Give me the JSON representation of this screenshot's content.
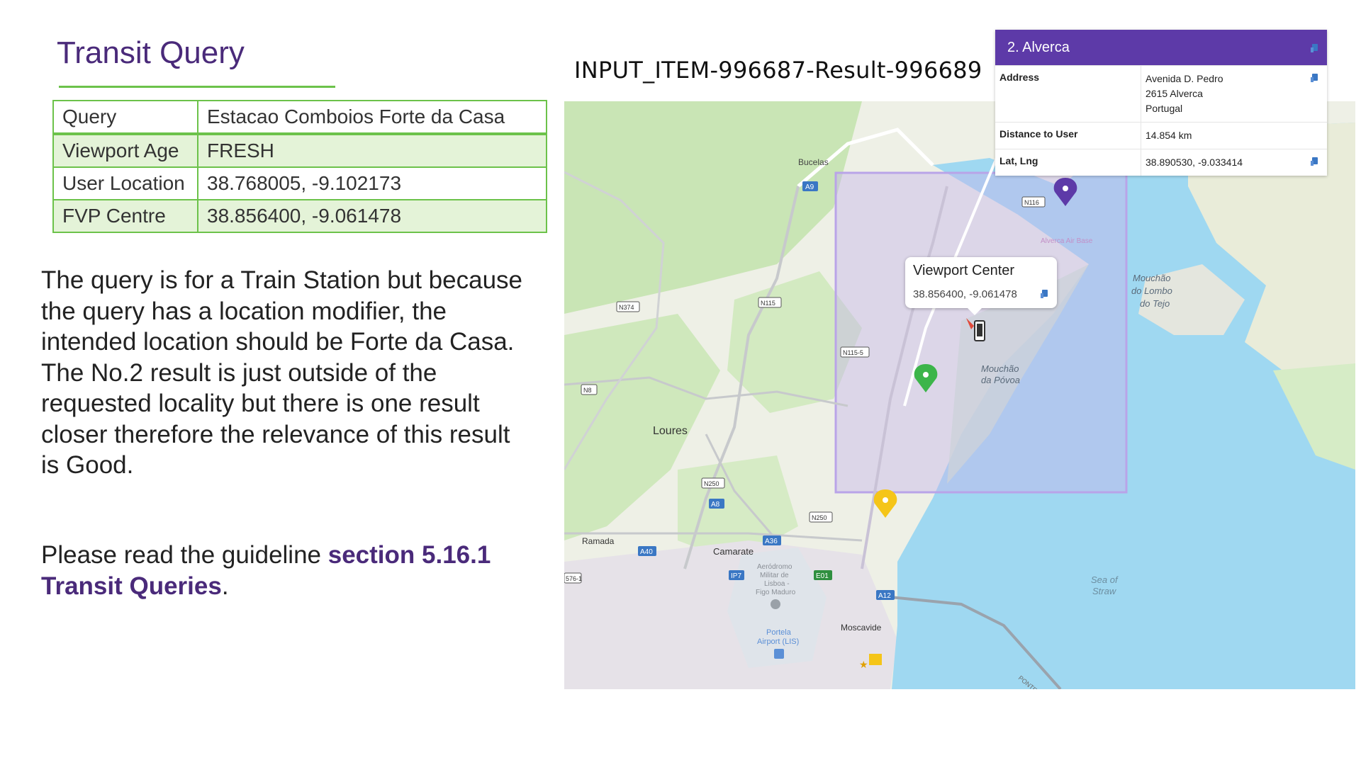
{
  "slide": {
    "title": "Transit Query",
    "item_id": "INPUT_ITEM-996687-Result-996689"
  },
  "info_table": [
    {
      "key": "Query",
      "value": "Estacao Comboios Forte da Casa"
    },
    {
      "key": "Viewport Age",
      "value": "FRESH"
    },
    {
      "key": "User Location",
      "value": "38.768005, -9.102173"
    },
    {
      "key": "FVP Centre",
      "value": "38.856400, -9.061478"
    }
  ],
  "description": {
    "para1": "The query is for a Train Station but because the query has a location modifier, the intended location should be Forte da Casa.",
    "para2": "The No.2 result is just outside of the requested locality but there is one result closer therefore the relevance of this result is Good.",
    "guide_prefix": "Please read the guideline ",
    "guide_link": "section 5.16.1 Transit Queries",
    "guide_suffix": "."
  },
  "result_card": {
    "title": "2. Alverca",
    "rows": {
      "address_label": "Address",
      "address_lines": [
        "Avenida D. Pedro",
        "2615 Alverca",
        "Portugal"
      ],
      "distance_label": "Distance to User",
      "distance_value": "14.854 km",
      "latlng_label": "Lat, Lng",
      "latlng_value": "38.890530, -9.033414"
    }
  },
  "viewport_tooltip": {
    "title": "Viewport Center",
    "coords": "38.856400, -9.061478"
  },
  "map": {
    "labels": {
      "bucelas": "Bucelas",
      "loures": "Loures",
      "ramada": "Ramada",
      "camarate": "Camarate",
      "moscavide": "Moscavide",
      "alverca_air_base": "Alverca Air Base",
      "mouchao_lombo": [
        "Mouchão",
        "do Lombo",
        "do Tejo"
      ],
      "mouchao_povoa": [
        "Mouchão",
        "da Póvoa"
      ],
      "sea_of_straw": [
        "Sea of",
        "Straw"
      ],
      "aerodromo": [
        "Aeródromo",
        "Militar de",
        "Lisboa -",
        "Figo Maduro"
      ],
      "portela": [
        "Portela",
        "Airport (LIS)"
      ],
      "ponte": "PONTE"
    },
    "road_shields": {
      "a9": "A9",
      "n116": "N116",
      "n374": "N374",
      "n115": "N115",
      "n115_5": "N115-5",
      "n8": "N8",
      "n250a": "N250",
      "a8": "A8",
      "n250b": "N250",
      "a36": "A36",
      "a40": "A40",
      "ip7": "IP7",
      "e01": "E01",
      "a12": "A12",
      "r576": "576-1"
    },
    "colors": {
      "land": "#eef0e6",
      "green": "#c9e5b5",
      "water": "#9fd8f1",
      "urban": "#e3dde6",
      "viewport_box": "#c6b6ea",
      "pin_purple": "#5d3aa8",
      "pin_green": "#3cb54a",
      "pin_yellow": "#f5c518"
    }
  }
}
